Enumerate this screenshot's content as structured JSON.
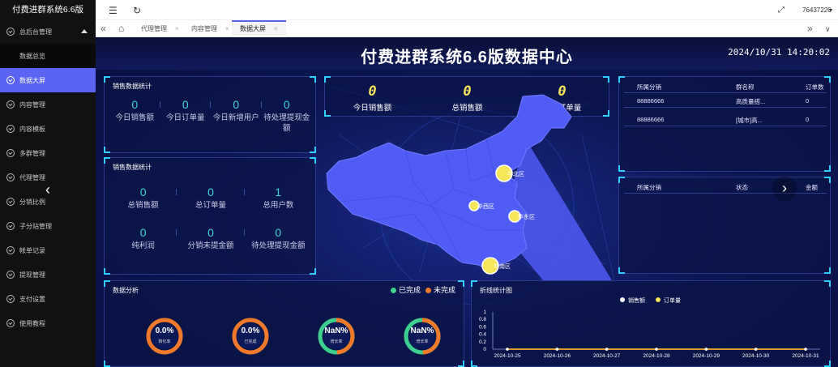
{
  "brand": "付费进群系统6.6版",
  "sidebar": {
    "items": [
      {
        "label": "总后台管理",
        "sub": false,
        "active": false,
        "caret": true
      },
      {
        "label": "数据总览",
        "sub": true,
        "active": false
      },
      {
        "label": "数据大屏",
        "sub": false,
        "active": true
      },
      {
        "label": "内容管理",
        "sub": false,
        "active": false
      },
      {
        "label": "内容模板",
        "sub": false,
        "active": false
      },
      {
        "label": "多群管理",
        "sub": false,
        "active": false
      },
      {
        "label": "代理管理",
        "sub": false,
        "active": false
      },
      {
        "label": "分销比例",
        "sub": false,
        "active": false
      },
      {
        "label": "子分站管理",
        "sub": false,
        "active": false
      },
      {
        "label": "帐单记录",
        "sub": false,
        "active": false
      },
      {
        "label": "提现管理",
        "sub": false,
        "active": false
      },
      {
        "label": "支付设置",
        "sub": false,
        "active": false
      },
      {
        "label": "使用教程",
        "sub": false,
        "active": false
      }
    ]
  },
  "topbar": {
    "menu_icon": "☰",
    "refresh_icon": "↻",
    "fullscreen_icon": "⤢",
    "user": "76437226",
    "user_caret": "▾"
  },
  "tabs": {
    "prev": "«",
    "home_icon": "⌂",
    "items": [
      {
        "label": "代理管理",
        "active": false
      },
      {
        "label": "内容管理",
        "active": false
      },
      {
        "label": "数据大屏",
        "active": true
      }
    ],
    "close": "×",
    "next": "»",
    "more": "∨"
  },
  "screen": {
    "title": "付费进群系统6.6版数据中心",
    "datetime": "2024/10/31 14:20:02",
    "sales_panel": {
      "title": "销售数据统计",
      "stats": [
        {
          "value": "0",
          "label": "今日销售额"
        },
        {
          "value": "0",
          "label": "今日订单量"
        },
        {
          "value": "0",
          "label": "今日新增用户"
        },
        {
          "value": "0",
          "label": "待处理提现金额"
        }
      ]
    },
    "sales_panel2": {
      "title": "销售数据统计",
      "stats": [
        {
          "value": "0",
          "label": "总销售额"
        },
        {
          "value": "0",
          "label": "总订单量"
        },
        {
          "value": "1",
          "label": "总用户数"
        },
        {
          "value": "0",
          "label": "纯利润"
        },
        {
          "value": "0",
          "label": "分销未提金额"
        },
        {
          "value": "0",
          "label": "待处理提现金额"
        }
      ]
    },
    "kpis": [
      {
        "value": "0",
        "label": "今日销售额"
      },
      {
        "value": "0",
        "label": "总销售额"
      },
      {
        "value": "0",
        "label": "今日订单量"
      }
    ],
    "map_labels": [
      "华北区",
      "华西区",
      "华东区",
      "华南区"
    ],
    "table1": {
      "headers": [
        "所属分销",
        "群名称",
        "订单数"
      ],
      "rows": [
        [
          "88886666",
          "高质量搭...",
          "0"
        ],
        [
          "88886666",
          "[城市]高...",
          "0"
        ]
      ]
    },
    "table2": {
      "headers": [
        "所属分销",
        "状态",
        "金额"
      ]
    },
    "analysis": {
      "title": "数据分析",
      "legend": [
        {
          "label": "已完成",
          "color": "#3ecf8e"
        },
        {
          "label": "未完成",
          "color": "#f07a2c"
        }
      ],
      "rings": [
        {
          "value": "0.0%",
          "label": "转化率",
          "kind": "orange"
        },
        {
          "value": "0.0%",
          "label": "已完成",
          "kind": "orange"
        },
        {
          "value": "NaN%",
          "label": "增长率",
          "kind": "mixed"
        },
        {
          "value": "NaN%",
          "label": "增长率",
          "kind": "mixed"
        }
      ]
    },
    "nav_prev": "‹",
    "nav_next": "›"
  },
  "chart_data": {
    "type": "line",
    "title": "折线统计图",
    "x": [
      "2024-10-25",
      "2024-10-26",
      "2024-10-27",
      "2024-10-28",
      "2024-10-29",
      "2024-10-30",
      "2024-10-31"
    ],
    "series": [
      {
        "name": "销售额",
        "values": [
          0,
          0,
          0,
          0,
          0,
          0,
          0
        ],
        "color": "#ffffff"
      },
      {
        "name": "订单量",
        "values": [
          0,
          0,
          0,
          0,
          0,
          0,
          0
        ],
        "color": "#f7e55a"
      }
    ],
    "y_ticks": [
      "1",
      "0.8",
      "0.6",
      "0.4",
      "0.2",
      "0"
    ],
    "ylim": [
      0,
      1
    ],
    "legend_position": "top-center"
  },
  "colors": {
    "accent": "#5b63f2",
    "cyan": "#3fd3e0",
    "yellow": "#f7e55a",
    "map": "#4f5cf6"
  }
}
